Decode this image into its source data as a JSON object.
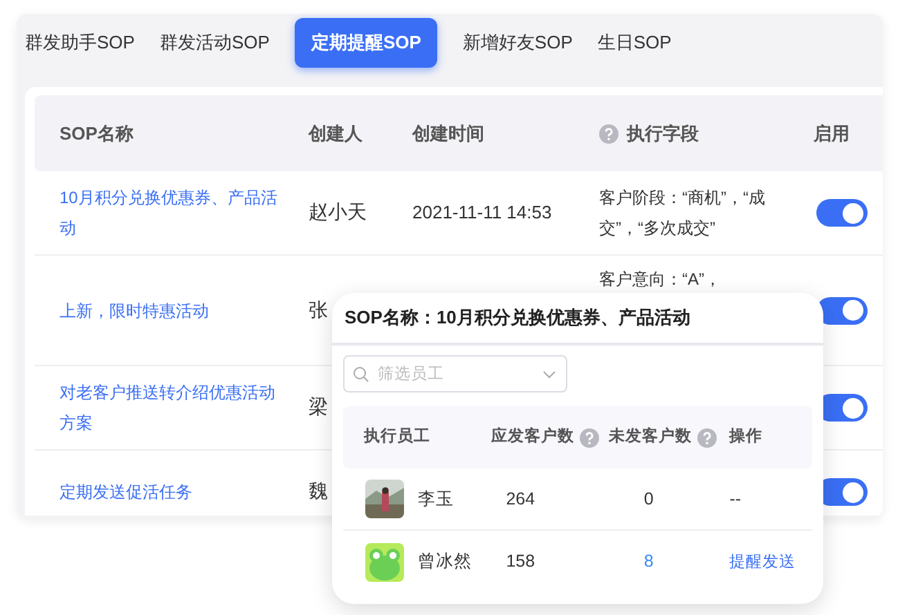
{
  "tabs": [
    {
      "label": "群发助手SOP",
      "selected": false
    },
    {
      "label": "群发活动SOP",
      "selected": false
    },
    {
      "label": "定期提醒SOP",
      "selected": true
    },
    {
      "label": "新增好友SOP",
      "selected": false
    },
    {
      "label": "生日SOP",
      "selected": false
    }
  ],
  "table": {
    "columns": [
      "SOP名称",
      "创建人",
      "创建时间",
      "执行字段",
      "启用"
    ],
    "rows": [
      {
        "name": "10月积分兑换优惠券、产品活动",
        "creator": "赵小天",
        "created": "2021-11-11 14:53",
        "field": "客户阶段：“商机”，“成交”，“多次成交”",
        "on": true
      },
      {
        "name": "上新，限时特惠活动",
        "creator": "张",
        "field": "客户意向：“A”，",
        "on": true
      },
      {
        "name": "对老客户推送转介绍优惠活动方案",
        "creator": "梁",
        "on": true
      },
      {
        "name": "定期发送促活任务",
        "creator": "魏",
        "on": true
      }
    ]
  },
  "popup": {
    "title": "SOP名称：10月积分兑换优惠券、产品活动",
    "search": {
      "placeholder": "筛选员工"
    },
    "columns": [
      "执行员工",
      "应发客户数",
      "未发客户数",
      "操作"
    ],
    "rows": [
      {
        "name": "李玉",
        "due": "264",
        "unsent": "0",
        "action": "--",
        "actionable": false
      },
      {
        "name": "曾冰然",
        "due": "158",
        "unsent": "8",
        "action": "提醒发送",
        "actionable": true
      }
    ]
  }
}
